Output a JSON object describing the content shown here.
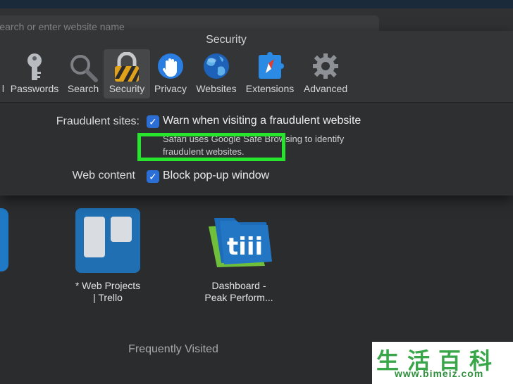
{
  "browser": {
    "tab_text": "                                          ",
    "address_placeholder": "Search or enter website name"
  },
  "preferences": {
    "title": "Security",
    "tabs": [
      {
        "label": "l",
        "icon": "general-icon"
      },
      {
        "label": "Passwords",
        "icon": "key-icon"
      },
      {
        "label": "Search",
        "icon": "magnifier-icon"
      },
      {
        "label": "Security",
        "icon": "padlock-icon",
        "active": true
      },
      {
        "label": "Privacy",
        "icon": "hand-icon"
      },
      {
        "label": "Websites",
        "icon": "globe-icon"
      },
      {
        "label": "Extensions",
        "icon": "puzzle-compass-icon"
      },
      {
        "label": "Advanced",
        "icon": "gear-icon"
      }
    ],
    "fraudulent": {
      "label": "Fraudulent sites:",
      "checkbox_text": "Warn when visiting a fraudulent website",
      "checked": true,
      "help_line1": "Safari uses Google Safe Browsing to identify",
      "help_line2": "fraudulent websites."
    },
    "web_content": {
      "label": "Web content",
      "checkbox_text": "Block pop-up window",
      "checked": true
    }
  },
  "favorites": {
    "tiles": [
      {
        "title_line1": "* Web Projects",
        "title_line2": "| Trello",
        "icon": "trello-icon"
      },
      {
        "title_line1": "Dashboard -",
        "title_line2": "Peak Perform...",
        "icon": "folder-tiii-icon"
      }
    ],
    "frequently_visited_label": "Frequently Visited"
  },
  "watermark": {
    "chars": "生活百科",
    "url": "www.bimeiz.com"
  },
  "colors": {
    "highlight": "#27e52c",
    "checkbox": "#2b6fd6",
    "trello": "#1f6fb2"
  }
}
